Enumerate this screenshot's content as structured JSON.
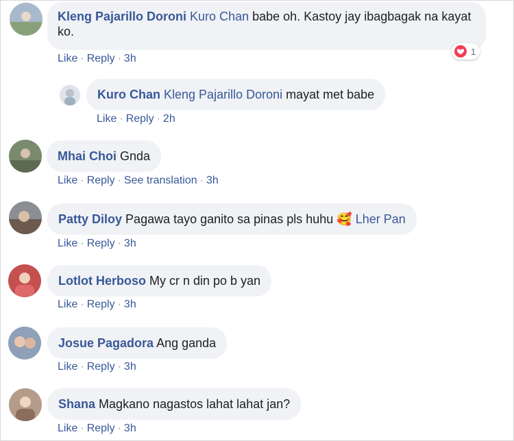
{
  "labels": {
    "like": "Like",
    "reply": "Reply",
    "see_translation": "See translation"
  },
  "comments": [
    {
      "author": "Kleng Pajarillo Doroni",
      "mention": "Kuro Chan",
      "text": "babe oh. Kastoy jay ibagbagak na kayat ko.",
      "time": "3h",
      "reaction_count": "1",
      "avatar_color": "#a7b9cc"
    },
    {
      "author": "Kuro Chan",
      "mention": "Kleng Pajarillo Doroni",
      "text": "mayat met babe",
      "time": "2h",
      "avatar_color": "#c9d3db"
    },
    {
      "author": "Mhai Choi",
      "text": "Gnda",
      "time": "3h",
      "avatar_color": "#7a8a6e"
    },
    {
      "author": "Patty Diloy",
      "text": "Pagawa tayo ganito sa pinas pls huhu",
      "emoji": "🥰",
      "mention": "Lher Pan",
      "time": "3h",
      "avatar_color": "#8b8f94"
    },
    {
      "author": "Lotlot Herboso",
      "text": "My cr n din po b yan",
      "time": "3h",
      "avatar_color": "#c4514f"
    },
    {
      "author": "Josue Pagadora",
      "text": "Ang ganda",
      "time": "3h",
      "avatar_color": "#8fa0b8"
    },
    {
      "author": "Shana",
      "text": "Magkano nagastos lahat lahat jan?",
      "time": "3h",
      "avatar_color": "#b59c8a"
    }
  ]
}
